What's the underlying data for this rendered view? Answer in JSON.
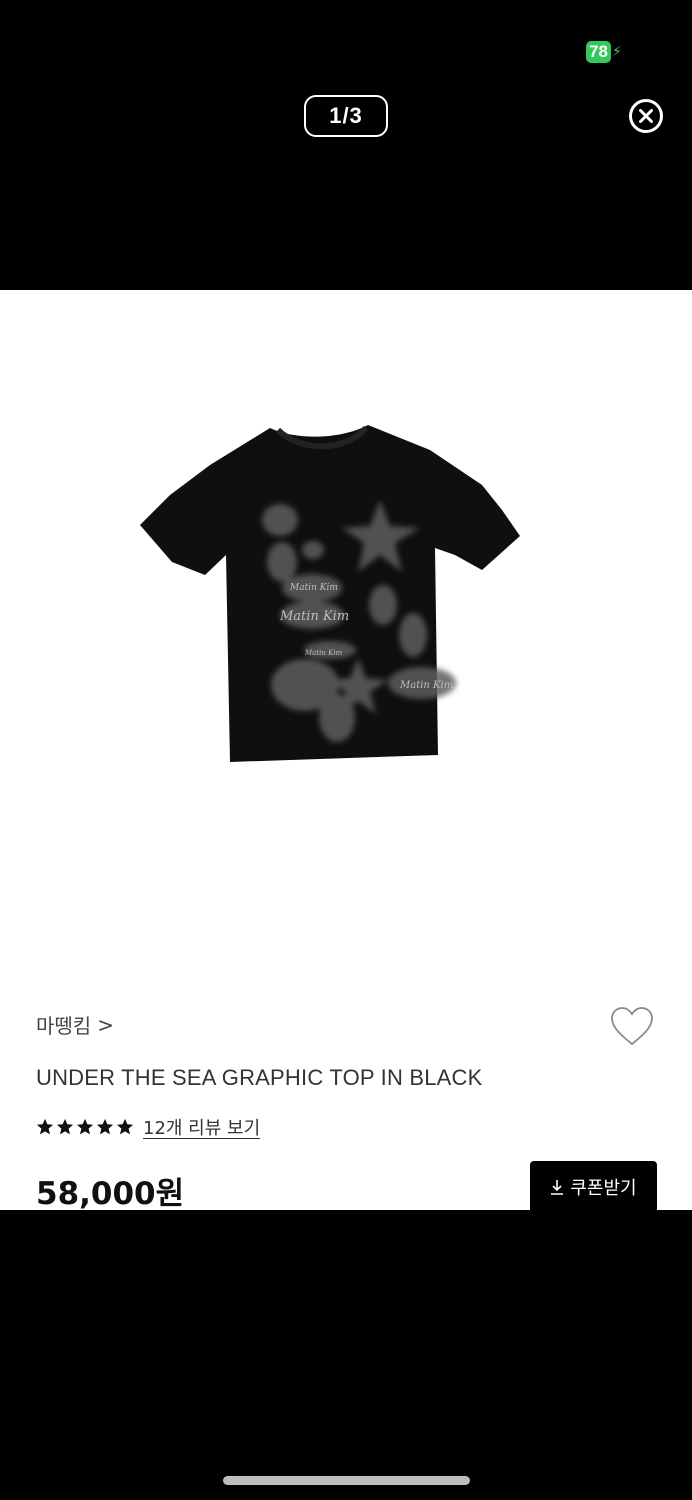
{
  "status_bar": {
    "battery_level": "78"
  },
  "viewer": {
    "page_counter": "1/3"
  },
  "product": {
    "brand": "마뗑킴",
    "title": "UNDER THE SEA GRAPHIC TOP IN BLACK",
    "rating_stars": 5,
    "review_link": "12개 리뷰 보기",
    "price": "58,000원",
    "coupon_button": "쿠폰받기",
    "wishlist_icon": "heart-outline-icon",
    "image_icon": "tshirt-black-graphic"
  },
  "colors": {
    "background": "#000000",
    "card": "#ffffff",
    "battery": "#34c759",
    "button": "#000000"
  }
}
